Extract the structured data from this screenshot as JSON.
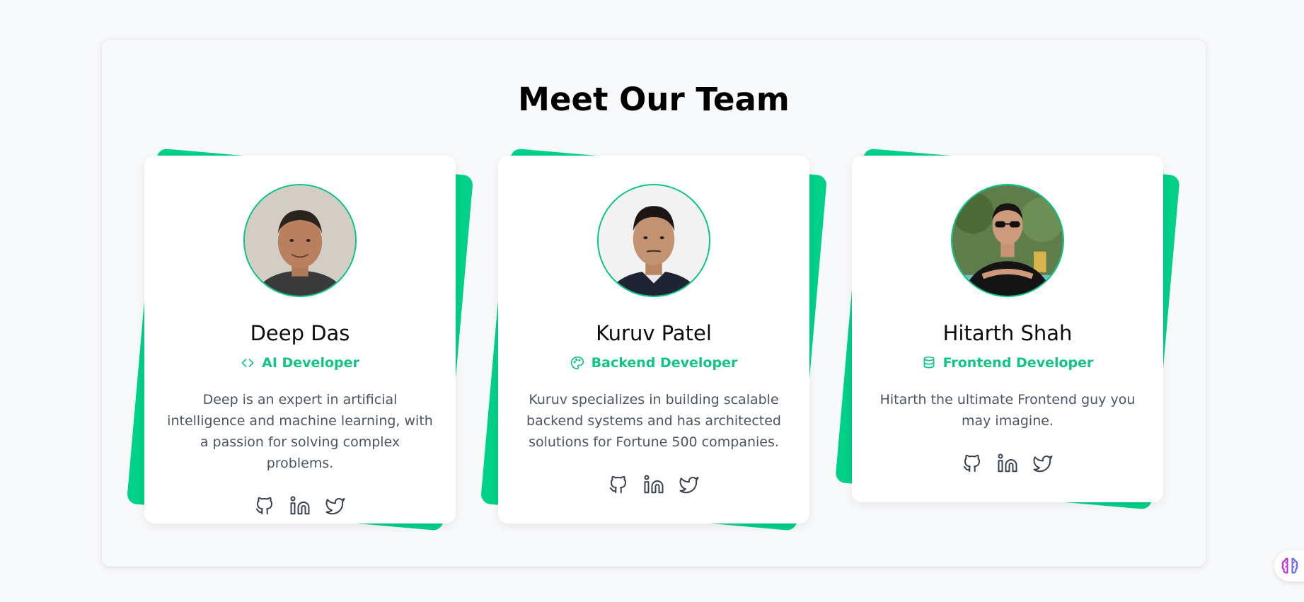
{
  "page": {
    "title": "Meet Our Team"
  },
  "colors": {
    "accent": "#00d188",
    "role_text": "#10c483",
    "desc_text": "#4b5563",
    "icon_stroke": "#374151"
  },
  "team": [
    {
      "name": "Deep Das",
      "role": "AI Developer",
      "role_icon": "code-icon",
      "description": "Deep is an expert in artificial intelligence and machine learning, with a passion for solving complex problems.",
      "socials": [
        "github-icon",
        "linkedin-icon",
        "twitter-icon"
      ]
    },
    {
      "name": "Kuruv Patel",
      "role": "Backend Developer",
      "role_icon": "palette-icon",
      "description": "Kuruv specializes in building scalable backend systems and has architected solutions for Fortune 500 companies.",
      "socials": [
        "github-icon",
        "linkedin-icon",
        "twitter-icon"
      ]
    },
    {
      "name": "Hitarth Shah",
      "role": "Frontend Developer",
      "role_icon": "database-icon",
      "description": "Hitarth the ultimate Frontend guy you may imagine.",
      "socials": [
        "github-icon",
        "linkedin-icon",
        "twitter-icon"
      ]
    }
  ],
  "floating": {
    "icon": "brain-icon"
  }
}
